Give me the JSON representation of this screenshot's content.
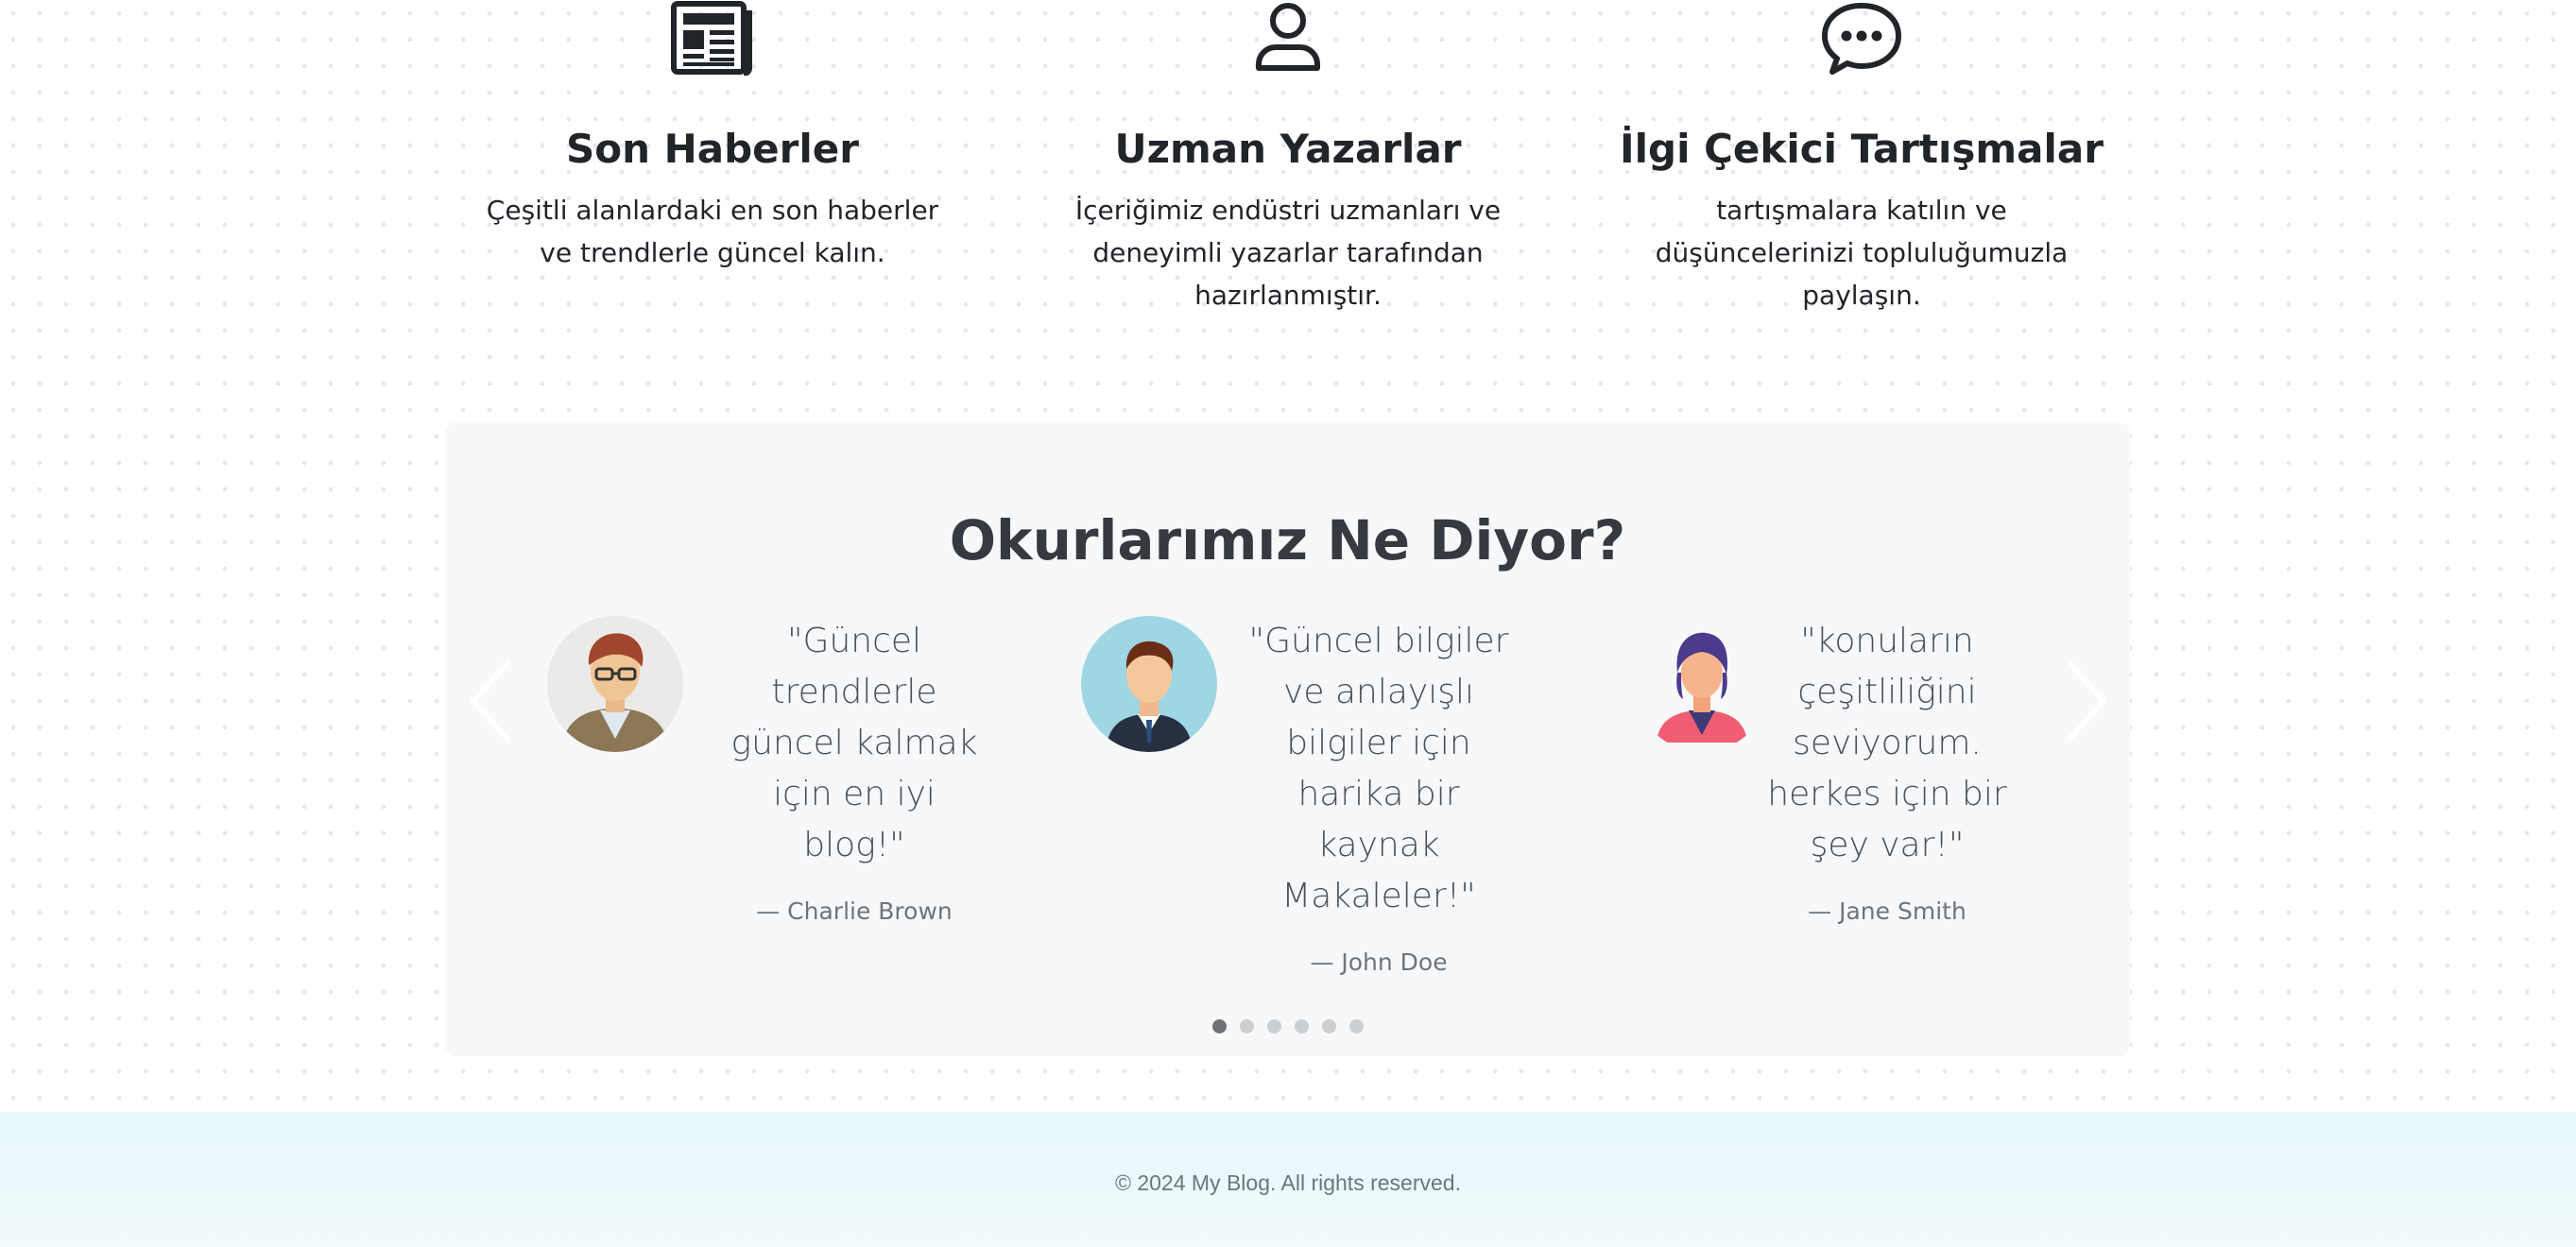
{
  "features": [
    {
      "icon": "newspaper-icon",
      "title": "Son Haberler",
      "text": "Çeşitli alanlardaki en son haberler ve trendlerle güncel kalın."
    },
    {
      "icon": "person-icon",
      "title": "Uzman Yazarlar",
      "text": "İçeriğimiz endüstri uzmanları ve deneyimli yazarlar tarafından hazırlanmıştır."
    },
    {
      "icon": "chat-bubble-icon",
      "title": "İlgi Çekici Tartışmalar",
      "text": "tartışmalara katılın ve düşüncelerinizi topluluğumuzla paylaşın."
    }
  ],
  "testimonials": {
    "title": "Okurlarımız Ne Diyor?",
    "items": [
      {
        "avatar": "man-glasses-avatar",
        "quote": "\"Güncel trendlerle güncel kalmak için en iyi blog!\"",
        "author": "— Charlie Brown"
      },
      {
        "avatar": "man-suit-avatar",
        "quote": "\"Güncel bilgiler ve anlayışlı bilgiler için harika bir kaynak Makaleler!\"",
        "author": "— John Doe"
      },
      {
        "avatar": "woman-avatar",
        "quote": "\"konuların çeşitliliğini seviyorum. herkes için bir şey var!\"",
        "author": "— Jane Smith"
      }
    ],
    "prev_icon": "chevron-left-icon",
    "next_icon": "chevron-right-icon",
    "slide_count": 6,
    "active_slide": 1
  },
  "footer": {
    "text": "© 2024 My Blog. All rights reserved."
  },
  "colors": {
    "heading": "#212529",
    "testimonial_bg": "#f7f8f9",
    "footer_bg": "#e6f7fa",
    "dot_active": "#6e7276",
    "dot_inactive": "#cccfd2"
  }
}
